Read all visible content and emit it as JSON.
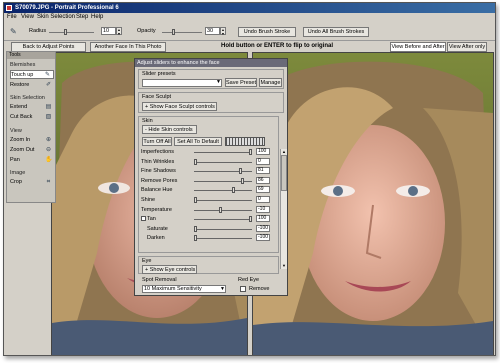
{
  "window": {
    "title": "S70079.JPG - Portrait Professional 6"
  },
  "menu": [
    "File",
    "View",
    "Skin Selection",
    "Step",
    "Help"
  ],
  "toolbar": {
    "radius_label": "Radius",
    "radius_value": "10",
    "opacity_label": "Opacity",
    "opacity_value": "30",
    "undo_brush": "Undo Brush Stroke",
    "undo_all_brush": "Undo All Brush Strokes"
  },
  "nav": {
    "back": "Back to Adjust Points",
    "another_face": "Another Face In This Photo",
    "hint": "Hold button or ENTER to flip to original",
    "view_before_after": "View Before and After",
    "view_after_only": "View After only"
  },
  "left_panel": {
    "tools": "Tools",
    "blemishes": "Blemishes",
    "touch_up": "Touch up",
    "restore": "Restore",
    "skin_selection": "Skin Selection",
    "extend": "Extend",
    "cut_back": "Cut Back",
    "view": "View",
    "zoom_in": "Zoom In",
    "zoom_out": "Zoom Out",
    "pan": "Pan",
    "image": "Image",
    "crop": "Crop"
  },
  "adjust_panel": {
    "title": "Adjust sliders to enhance the face",
    "slider_presets": "Slider presets",
    "preset_value": "",
    "save_preset": "Save Preset",
    "manage": "Manage",
    "face_sculpt": "Face Sculpt",
    "show_face_sculpt": "+ Show Face Sculpt controls",
    "skin": "Skin",
    "hide_skin": "- Hide Skin controls",
    "turn_off_all": "Turn Off All",
    "set_all_default": "Set All To Default",
    "sliders": [
      {
        "label": "Imperfections",
        "value": "100",
        "level": 1.0
      },
      {
        "label": "Thin Wrinkles",
        "value": "0",
        "level": 0.0
      },
      {
        "label": "Fine Shadows",
        "value": "81",
        "level": 0.81
      },
      {
        "label": "Remove Pores",
        "value": "86",
        "level": 0.86
      },
      {
        "label": "Balance Hue",
        "value": "69",
        "level": 0.69
      },
      {
        "label": "Shine",
        "value": "0",
        "level": 0.0
      },
      {
        "label": "Temperature",
        "value": "-10",
        "level": 0.45
      },
      {
        "label": "Tan",
        "value": "100",
        "level": 1.0
      },
      {
        "label": "Saturate",
        "value": "-100",
        "level": 0.0
      },
      {
        "label": "Darken",
        "value": "-100",
        "level": 0.0
      }
    ],
    "eye": "Eye",
    "show_eye": "+ Show Eye controls",
    "spot_removal": "Spot Removal",
    "spot_value": "10 Maximum Sensitivity",
    "red_eye": "Red Eye",
    "remove": "Remove"
  },
  "colors": {
    "titlebar": "#0a246a",
    "panel": "#d4d0c8",
    "panel_title": "#6a6a78"
  }
}
